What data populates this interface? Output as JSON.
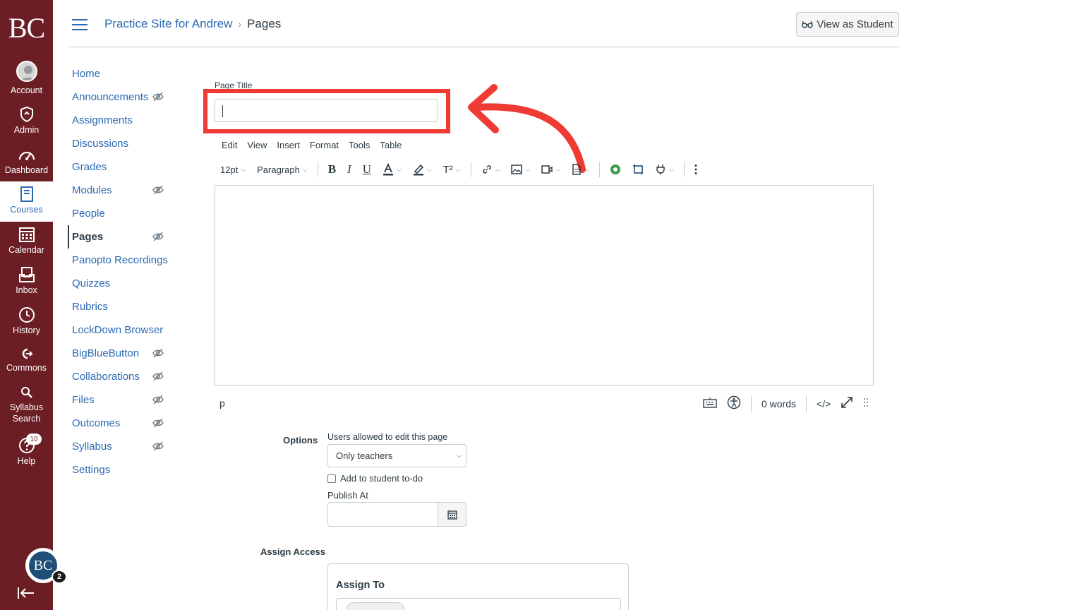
{
  "global_nav": {
    "logo": "BC",
    "items": [
      {
        "label": "Account",
        "icon": "account-icon"
      },
      {
        "label": "Admin",
        "icon": "admin-shield-icon"
      },
      {
        "label": "Dashboard",
        "icon": "dashboard-gauge-icon"
      },
      {
        "label": "Courses",
        "icon": "courses-book-icon",
        "active": true
      },
      {
        "label": "Calendar",
        "icon": "calendar-icon"
      },
      {
        "label": "Inbox",
        "icon": "inbox-icon"
      },
      {
        "label": "History",
        "icon": "history-clock-icon"
      },
      {
        "label": "Commons",
        "icon": "commons-icon"
      },
      {
        "label": "Syllabus Search",
        "icon": "syllabus-search-icon"
      },
      {
        "label": "Help",
        "icon": "help-icon",
        "badge": "10"
      }
    ],
    "user_avatar": "BC",
    "user_badge": "2",
    "colors": {
      "nav_bg": "#6b1f24",
      "link": "#2b6ab3",
      "highlight": "#ef3b33"
    }
  },
  "header": {
    "breadcrumb_course": "Practice Site for Andrew",
    "breadcrumb_separator": "›",
    "breadcrumb_current": "Pages",
    "view_as_student": "View as Student"
  },
  "course_nav": {
    "items": [
      {
        "label": "Home",
        "hidden": false
      },
      {
        "label": "Announcements",
        "hidden": true
      },
      {
        "label": "Assignments",
        "hidden": false
      },
      {
        "label": "Discussions",
        "hidden": false
      },
      {
        "label": "Grades",
        "hidden": false
      },
      {
        "label": "Modules",
        "hidden": true
      },
      {
        "label": "People",
        "hidden": false
      },
      {
        "label": "Pages",
        "hidden": true,
        "active": true
      },
      {
        "label": "Panopto Recordings",
        "hidden": false
      },
      {
        "label": "Quizzes",
        "hidden": false
      },
      {
        "label": "Rubrics",
        "hidden": false
      },
      {
        "label": "LockDown Browser",
        "hidden": false
      },
      {
        "label": "BigBlueButton",
        "hidden": true
      },
      {
        "label": "Collaborations",
        "hidden": true
      },
      {
        "label": "Files",
        "hidden": true
      },
      {
        "label": "Outcomes",
        "hidden": true
      },
      {
        "label": "Syllabus",
        "hidden": true
      },
      {
        "label": "Settings",
        "hidden": false
      }
    ]
  },
  "editor": {
    "page_title_label": "Page Title",
    "page_title_value": "",
    "menubar": [
      "Edit",
      "View",
      "Insert",
      "Format",
      "Tools",
      "Table"
    ],
    "font_size": "12pt",
    "block_format": "Paragraph",
    "superscript_label": "T²",
    "status_path": "p",
    "word_count": "0 words",
    "html_toggle": "</>"
  },
  "options": {
    "label": "Options",
    "edit_permission_label": "Users allowed to edit this page",
    "edit_permission_value": "Only teachers",
    "todo_label": "Add to student to-do",
    "todo_checked": false,
    "publish_at_label": "Publish At",
    "publish_at_value": "",
    "assign_access_label": "Assign Access",
    "assign_to_label": "Assign To"
  }
}
